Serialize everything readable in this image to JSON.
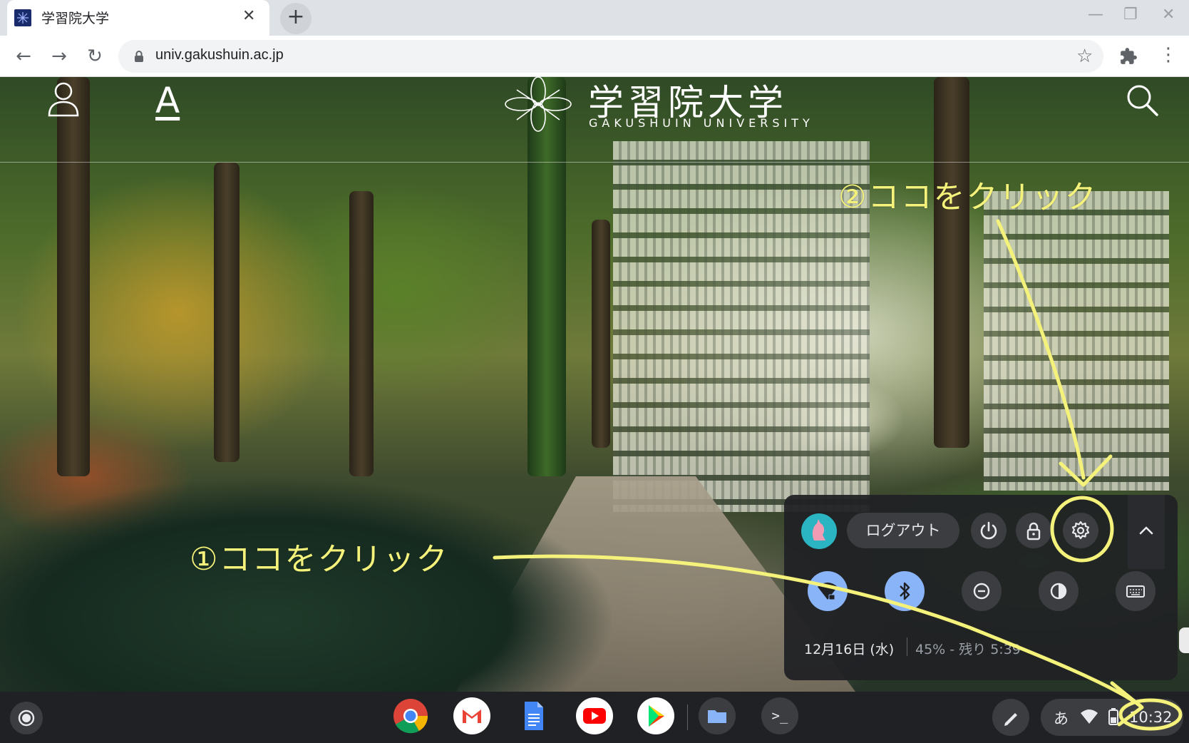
{
  "tab": {
    "title": "学習院大学",
    "close": "✕",
    "new_tab": "+"
  },
  "window_controls": {
    "minimize": "—",
    "maximize": "❐",
    "close": "✕"
  },
  "nav": {
    "back": "←",
    "forward": "→",
    "reload": "↻",
    "menu": "⋮",
    "star": "☆"
  },
  "omnibox": {
    "url": "univ.gakushuin.ac.jp"
  },
  "site": {
    "title": "学習院大学",
    "subtitle": "GAKUSHUIN UNIVERSITY",
    "font_button": "A"
  },
  "annotations": {
    "step1": "①ココをクリック",
    "step2": "②ココをクリック",
    "color": "#f4f27a"
  },
  "quick_settings": {
    "logout": "ログアウト",
    "date": "12月16日 (水)",
    "battery": "45% - 残り 5:39",
    "top_buttons": [
      "power-icon",
      "lock-icon",
      "gear-icon",
      "chevron-up-icon"
    ],
    "toggles": [
      "wifi-icon",
      "bluetooth-icon",
      "do-not-disturb-icon",
      "night-light-icon",
      "keyboard-icon"
    ]
  },
  "shelf": {
    "apps": [
      "chrome-icon",
      "gmail-icon",
      "docs-icon",
      "youtube-icon",
      "play-store-icon",
      "files-icon",
      "terminal-icon"
    ],
    "terminal_label": ">_",
    "ime": "あ",
    "clock": "10:32"
  },
  "colors": {
    "tabstrip": "#dee1e6",
    "accent_blue": "#8ab4f8",
    "shelf": "#202124"
  }
}
